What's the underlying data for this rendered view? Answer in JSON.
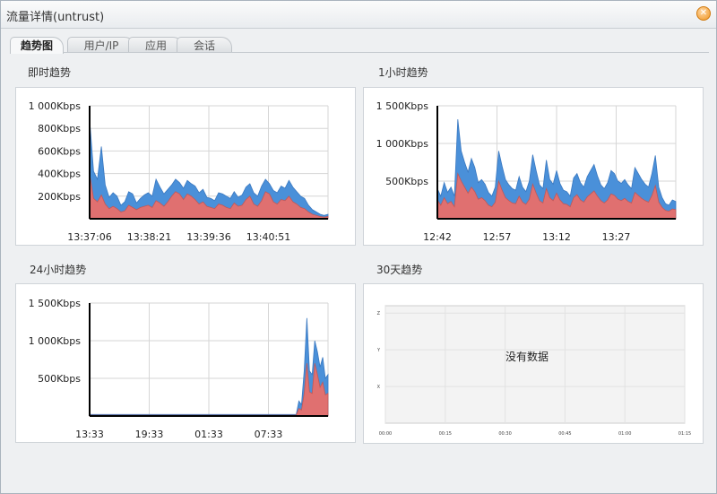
{
  "window": {
    "title": "流量详情(untrust)",
    "close_icon": "close-icon"
  },
  "tabs": [
    {
      "label": "趋势图",
      "active": true
    },
    {
      "label": "用户/IP",
      "active": false
    },
    {
      "label": "应用",
      "active": false
    },
    {
      "label": "会话",
      "active": false
    }
  ],
  "colors": {
    "series_blue": "#4a90d9",
    "series_red": "#e07070"
  },
  "panels": {
    "realtime": {
      "title": "即时趋势"
    },
    "hour1": {
      "title": "1小时趋势"
    },
    "hour24": {
      "title": "24小时趋势"
    },
    "day30": {
      "title": "30天趋势",
      "no_data": "没有数据"
    }
  },
  "chart_data": [
    {
      "type": "area",
      "title": "即时趋势",
      "y_unit": "Kbps",
      "ylim": [
        0,
        1000
      ],
      "yticks": [
        "200Kbps",
        "400Kbps",
        "600Kbps",
        "800Kbps",
        "1 000Kbps"
      ],
      "xticks": [
        "13:37:06",
        "13:38:21",
        "13:39:36",
        "13:40:51"
      ],
      "series": [
        {
          "color": "#4a90d9",
          "values": [
            880,
            420,
            350,
            640,
            300,
            190,
            230,
            200,
            120,
            150,
            240,
            220,
            140,
            180,
            210,
            230,
            200,
            350,
            280,
            220,
            260,
            300,
            350,
            320,
            270,
            340,
            310,
            290,
            230,
            260,
            190,
            180,
            160,
            230,
            220,
            200,
            180,
            240,
            190,
            210,
            280,
            310,
            230,
            200,
            290,
            350,
            310,
            250,
            230,
            290,
            270,
            340,
            280,
            240,
            200,
            180,
            120,
            80,
            60,
            40,
            30,
            40
          ]
        },
        {
          "color": "#e07070",
          "values": [
            400,
            180,
            150,
            210,
            130,
            90,
            110,
            90,
            60,
            70,
            120,
            100,
            80,
            100,
            110,
            120,
            100,
            160,
            140,
            110,
            150,
            200,
            240,
            220,
            170,
            220,
            200,
            170,
            130,
            150,
            110,
            100,
            90,
            130,
            120,
            100,
            90,
            140,
            110,
            120,
            170,
            200,
            130,
            110,
            160,
            240,
            220,
            150,
            130,
            170,
            160,
            200,
            150,
            130,
            100,
            90,
            60,
            40,
            30,
            20,
            15,
            20
          ]
        }
      ]
    },
    {
      "type": "area",
      "title": "1小时趋势",
      "y_unit": "Kbps",
      "ylim": [
        0,
        1500
      ],
      "yticks": [
        "500Kbps",
        "1 000Kbps",
        "1 500Kbps"
      ],
      "xticks": [
        "12:42",
        "12:57",
        "13:12",
        "13:27"
      ],
      "series": [
        {
          "color": "#4a90d9",
          "values": [
            400,
            300,
            480,
            350,
            420,
            300,
            1320,
            900,
            750,
            620,
            800,
            680,
            480,
            520,
            460,
            350,
            300,
            420,
            900,
            700,
            520,
            450,
            400,
            380,
            560,
            420,
            360,
            500,
            850,
            640,
            450,
            400,
            780,
            520,
            460,
            640,
            470,
            380,
            360,
            300,
            540,
            600,
            480,
            420,
            560,
            640,
            720,
            570,
            450,
            400,
            480,
            640,
            600,
            500,
            470,
            520,
            450,
            400,
            680,
            600,
            520,
            460,
            420,
            600,
            840,
            420,
            280,
            200,
            180,
            250,
            230
          ]
        },
        {
          "color": "#e07070",
          "values": [
            250,
            180,
            280,
            200,
            230,
            160,
            600,
            500,
            420,
            340,
            420,
            360,
            260,
            280,
            240,
            180,
            160,
            220,
            500,
            380,
            280,
            240,
            210,
            200,
            300,
            220,
            190,
            260,
            460,
            340,
            240,
            210,
            400,
            280,
            240,
            340,
            250,
            200,
            190,
            160,
            280,
            320,
            250,
            220,
            290,
            330,
            370,
            300,
            240,
            210,
            250,
            330,
            310,
            260,
            240,
            270,
            230,
            210,
            350,
            310,
            270,
            240,
            220,
            310,
            440,
            220,
            150,
            110,
            100,
            130,
            120
          ]
        }
      ]
    },
    {
      "type": "area",
      "title": "24小时趋势",
      "y_unit": "Kbps",
      "ylim": [
        0,
        1500
      ],
      "yticks": [
        "500Kbps",
        "1 000Kbps",
        "1 500Kbps"
      ],
      "xticks": [
        "13:33",
        "19:33",
        "01:33",
        "07:33"
      ],
      "series": [
        {
          "color": "#4a90d9",
          "values": [
            20,
            20,
            20,
            20,
            20,
            20,
            20,
            20,
            20,
            20,
            20,
            20,
            20,
            20,
            20,
            20,
            20,
            20,
            20,
            20,
            20,
            20,
            20,
            20,
            20,
            20,
            20,
            20,
            20,
            20,
            20,
            20,
            20,
            20,
            20,
            20,
            20,
            20,
            20,
            20,
            20,
            20,
            20,
            20,
            20,
            20,
            20,
            20,
            20,
            20,
            20,
            20,
            20,
            20,
            20,
            20,
            20,
            20,
            20,
            20,
            20,
            20,
            20,
            20,
            20,
            20,
            20,
            20,
            20,
            20,
            20,
            20,
            20,
            20,
            20,
            20,
            20,
            20,
            20,
            200,
            150,
            600,
            1300,
            600,
            550,
            1000,
            850,
            650,
            780,
            500,
            550
          ]
        },
        {
          "color": "#e07070",
          "values": [
            10,
            10,
            10,
            10,
            10,
            10,
            10,
            10,
            10,
            10,
            10,
            10,
            10,
            10,
            10,
            10,
            10,
            10,
            10,
            10,
            10,
            10,
            10,
            10,
            10,
            10,
            10,
            10,
            10,
            10,
            10,
            10,
            10,
            10,
            10,
            10,
            10,
            10,
            10,
            10,
            10,
            10,
            10,
            10,
            10,
            10,
            10,
            10,
            10,
            10,
            10,
            10,
            10,
            10,
            10,
            10,
            10,
            10,
            10,
            10,
            10,
            10,
            10,
            10,
            10,
            10,
            10,
            10,
            10,
            10,
            10,
            10,
            10,
            10,
            10,
            10,
            10,
            10,
            10,
            100,
            80,
            300,
            700,
            320,
            300,
            700,
            550,
            380,
            450,
            280,
            300
          ]
        }
      ]
    },
    {
      "type": "line",
      "title": "30天趋势",
      "series": [],
      "yticks": [
        "X",
        "Y",
        "Z"
      ],
      "xticks": [
        "00:00",
        "00:15",
        "00:30",
        "00:45",
        "01:00",
        "01:15"
      ]
    }
  ]
}
